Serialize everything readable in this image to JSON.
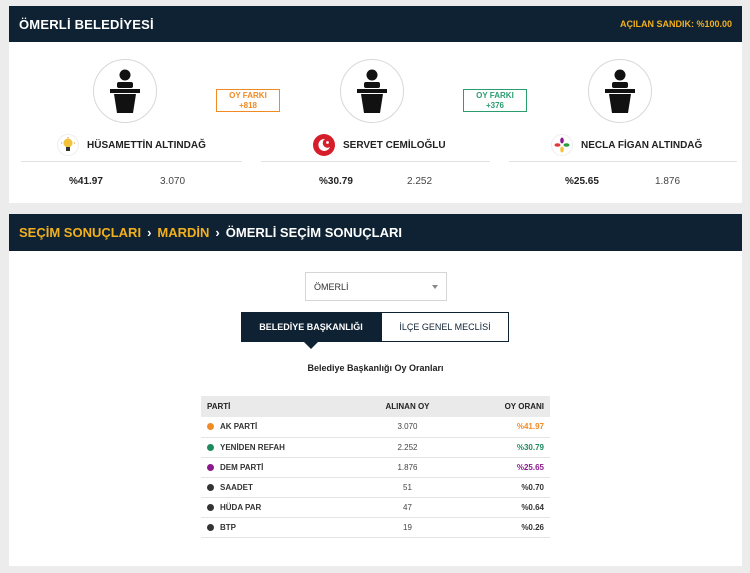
{
  "municipality": {
    "title": "ÖMERLİ BELEDİYESİ",
    "opened_ballot": "AÇILAN SANDIK: %100.00"
  },
  "candidates": [
    {
      "name": "HÜSAMETTİN ALTINDAĞ",
      "pct": "%41.97",
      "votes": "3.070",
      "party_icon": "ak-parti-bulb-icon"
    },
    {
      "name": "SERVET CEMİLOĞLU",
      "pct": "%30.79",
      "votes": "2.252",
      "party_icon": "yeniden-refah-icon"
    },
    {
      "name": "NECLA FİGAN ALTINDAĞ",
      "pct": "%25.65",
      "votes": "1.876",
      "party_icon": "dem-parti-icon"
    }
  ],
  "differences": [
    {
      "label": "OY FARKI",
      "value": "+818",
      "color": "#f08a24"
    },
    {
      "label": "OY FARKI",
      "value": "+376",
      "color": "#2a9d6f"
    }
  ],
  "breadcrumb": {
    "items": [
      "SEÇİM SONUÇLARI",
      "MARDİN"
    ],
    "current": "ÖMERLİ SEÇİM SONUÇLARI"
  },
  "district_select": {
    "value": "ÖMERLİ"
  },
  "tabs": [
    "BELEDİYE BAŞKANLIĞI",
    "İLÇE GENEL MECLİSİ"
  ],
  "results": {
    "title": "Belediye Başkanlığı Oy Oranları",
    "columns": [
      "PARTİ",
      "ALINAN OY",
      "OY ORANI"
    ],
    "rows": [
      {
        "party": "AK PARTİ",
        "votes": "3.070",
        "pct": "%41.97",
        "color": "#f08a24"
      },
      {
        "party": "YENİDEN REFAH",
        "votes": "2.252",
        "pct": "%30.79",
        "color": "#1e8a5e"
      },
      {
        "party": "DEM PARTİ",
        "votes": "1.876",
        "pct": "%25.65",
        "color": "#8a1a8c"
      },
      {
        "party": "SAADET",
        "votes": "51",
        "pct": "%0.70",
        "color": "#333333"
      },
      {
        "party": "HÜDA PAR",
        "votes": "47",
        "pct": "%0.64",
        "color": "#333333"
      },
      {
        "party": "BTP",
        "votes": "19",
        "pct": "%0.26",
        "color": "#333333"
      }
    ]
  }
}
